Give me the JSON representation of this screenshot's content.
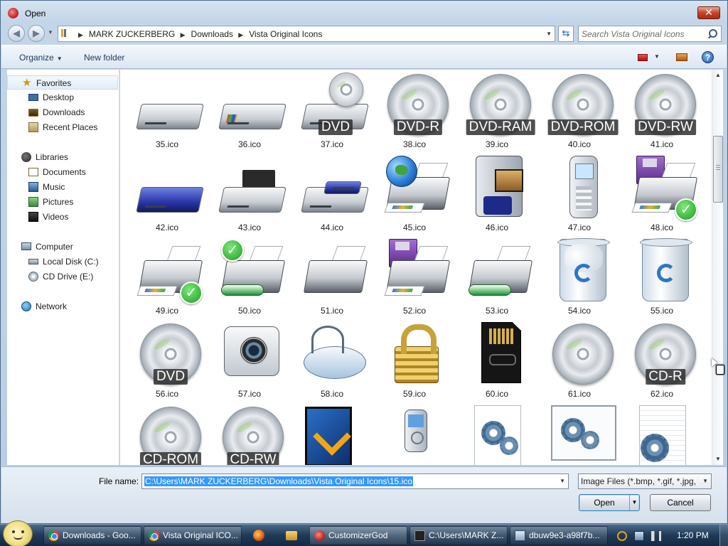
{
  "window": {
    "title": "Open",
    "close_label": "✕"
  },
  "address": {
    "breadcrumbs": [
      "MARK ZUCKERBERG",
      "Downloads",
      "Vista Original Icons"
    ]
  },
  "search": {
    "placeholder": "Search Vista Original Icons"
  },
  "toolbar": {
    "organize_label": "Organize",
    "new_folder_label": "New folder",
    "help_label": "?"
  },
  "navpane": {
    "favorites": {
      "label": "Favorites",
      "items": [
        "Desktop",
        "Downloads",
        "Recent Places"
      ]
    },
    "libraries": {
      "label": "Libraries",
      "items": [
        "Documents",
        "Music",
        "Pictures",
        "Videos"
      ]
    },
    "computer": {
      "label": "Computer",
      "items": [
        "Local Disk (C:)",
        "CD Drive (E:)"
      ]
    },
    "network": {
      "label": "Network"
    }
  },
  "files": [
    {
      "name": "35.ico",
      "icon": "drive-white"
    },
    {
      "name": "36.ico",
      "icon": "drive-windows"
    },
    {
      "name": "37.ico",
      "icon": "dvd-drive",
      "tag": "DVD"
    },
    {
      "name": "38.ico",
      "icon": "disc",
      "tag": "DVD-R"
    },
    {
      "name": "39.ico",
      "icon": "disc",
      "tag": "DVD-RAM"
    },
    {
      "name": "40.ico",
      "icon": "disc",
      "tag": "DVD-ROM"
    },
    {
      "name": "41.ico",
      "icon": "disc",
      "tag": "DVD-RW"
    },
    {
      "name": "42.ico",
      "icon": "drive-blue"
    },
    {
      "name": "43.ico",
      "icon": "tape-drive"
    },
    {
      "name": "44.ico",
      "icon": "drive-blue-slot"
    },
    {
      "name": "45.ico",
      "icon": "network-printer"
    },
    {
      "name": "46.ico",
      "icon": "camcorder"
    },
    {
      "name": "47.ico",
      "icon": "mobile-phone"
    },
    {
      "name": "48.ico",
      "icon": "fax-printer-default"
    },
    {
      "name": "49.ico",
      "icon": "printer-default"
    },
    {
      "name": "50.ico",
      "icon": "plotter-default"
    },
    {
      "name": "51.ico",
      "icon": "printer"
    },
    {
      "name": "52.ico",
      "icon": "fax-printer"
    },
    {
      "name": "53.ico",
      "icon": "plotter"
    },
    {
      "name": "54.ico",
      "icon": "recycle-bin-full"
    },
    {
      "name": "55.ico",
      "icon": "recycle-bin-empty"
    },
    {
      "name": "56.ico",
      "icon": "disc",
      "tag": "DVD"
    },
    {
      "name": "57.ico",
      "icon": "webcam"
    },
    {
      "name": "58.ico",
      "icon": "mouse"
    },
    {
      "name": "59.ico",
      "icon": "padlock"
    },
    {
      "name": "60.ico",
      "icon": "memory-card"
    },
    {
      "name": "61.ico",
      "icon": "disc"
    },
    {
      "name": "62.ico",
      "icon": "disc",
      "tag": "CD-R"
    },
    {
      "name": "",
      "icon": "disc",
      "tag": "CD-ROM"
    },
    {
      "name": "",
      "icon": "disc",
      "tag": "CD-RW"
    },
    {
      "name": "",
      "icon": "blue-book"
    },
    {
      "name": "",
      "icon": "media-player"
    },
    {
      "name": "",
      "icon": "settings-page"
    },
    {
      "name": "",
      "icon": "settings-window"
    },
    {
      "name": "",
      "icon": "settings-lined-page"
    }
  ],
  "footer": {
    "filename_label": "File name:",
    "filename_value": "C:\\Users\\MARK ZUCKERBERG\\Downloads\\Vista Original Icons\\15.ico",
    "filter_value": "Image Files (*.bmp, *.gif, *.jpg,",
    "open_label": "Open",
    "cancel_label": "Cancel"
  },
  "taskbar": {
    "tasks": [
      "Downloads - Goo...",
      "Vista Original ICO...",
      "CustomizerGod",
      "C:\\Users\\MARK Z...",
      "dbuw9e3-a98f7b..."
    ],
    "clock": "1:20 PM"
  },
  "colors": {
    "selection": "#3399ff",
    "window_frame": "#c3d5e8",
    "taskbar": "#1f3a57"
  }
}
